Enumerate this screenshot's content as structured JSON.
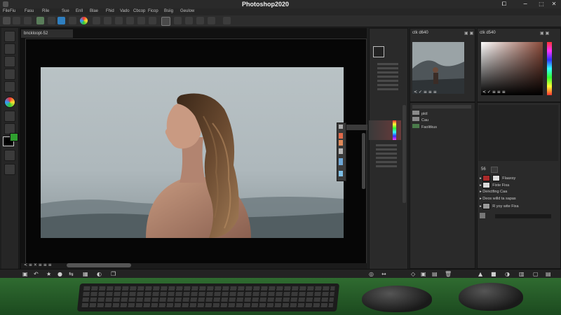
{
  "window": {
    "title": "Photoshop2020",
    "controls": [
      "⧠",
      "−",
      "⬚",
      "✕"
    ]
  },
  "menu": {
    "items": [
      "File",
      "Fiu",
      "Fasu",
      "Rile",
      "Sue",
      "Enll",
      "Blae",
      "Fhid",
      "Vado",
      "Cbcop",
      "Ficop",
      "Bsiig",
      "Geulow"
    ]
  },
  "options_bar": {
    "floating_label": "cA6"
  },
  "document": {
    "tab_label": "bnckloopt-52",
    "status_text": "< ≡ × ≡ ≡ ≡"
  },
  "navigator_panel": {
    "tab_label": "ctk d640"
  },
  "color_panel": {
    "tab_label": "ctk d540"
  },
  "thumb_nav": {
    "controls": "< ✓ ≡ ≡ ≡"
  },
  "thumb_color": {
    "controls": "< ✓ ≡ ≡ ≡"
  },
  "folders": {
    "items": [
      {
        "label": "pktl"
      },
      {
        "label": "Cau"
      },
      {
        "label": "Faolitkus"
      }
    ]
  },
  "layers": {
    "header_label": "56",
    "rows": [
      {
        "label": "Flaaxsy",
        "color": "#aa2a2a"
      },
      {
        "label": "Fixte Fixa",
        "color": "#d9d9d9"
      },
      {
        "label": "Denctfing Caa",
        "color": "#777777"
      },
      {
        "label": "Deos willd ta sapas",
        "color": "#888888"
      },
      {
        "label": "R yoy wite Fixa",
        "color": "#999999"
      }
    ]
  },
  "colors": {
    "accent_green": "#2fa02f",
    "foreground": "#ffffff",
    "background": "#000000"
  }
}
